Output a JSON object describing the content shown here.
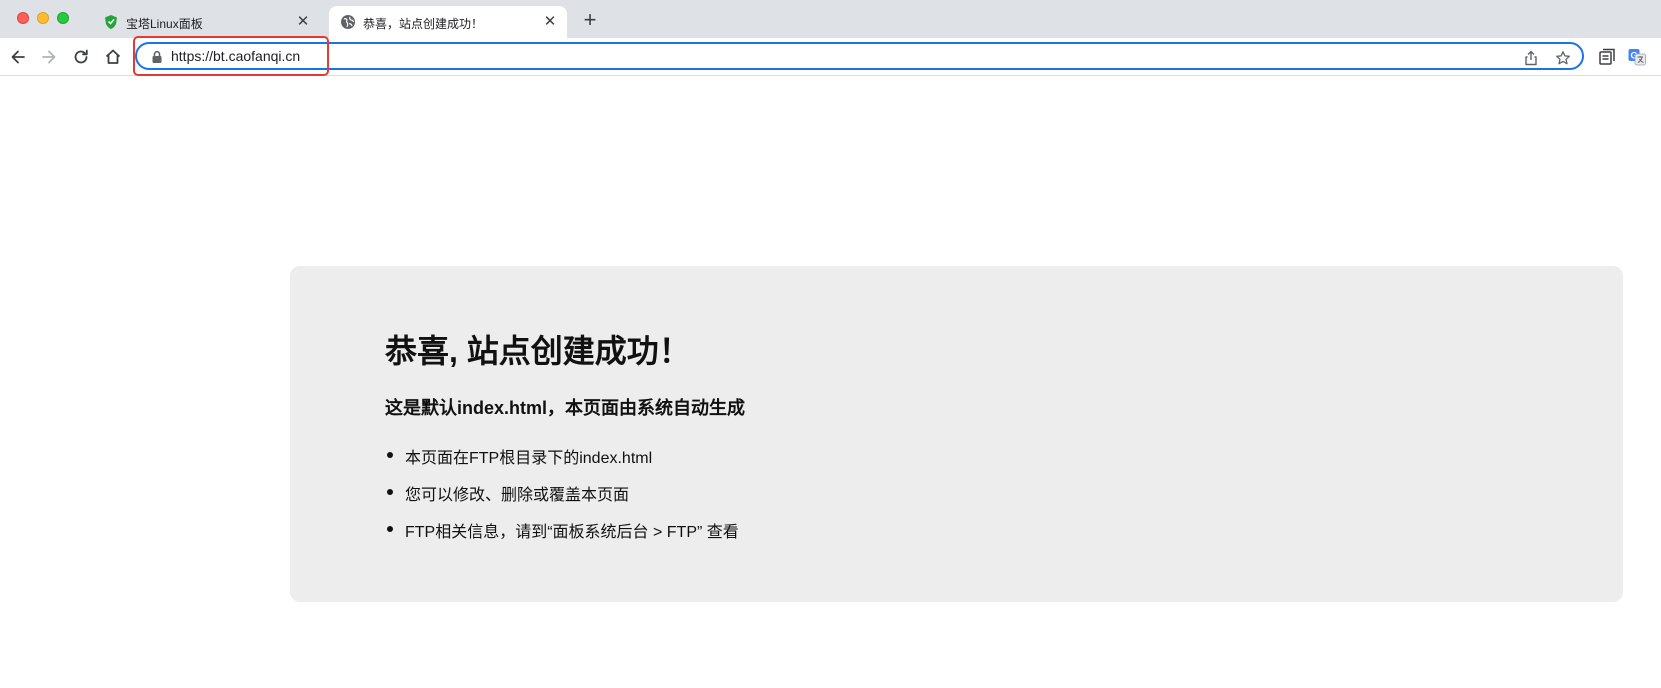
{
  "browser": {
    "tabs": [
      {
        "title": "宝塔Linux面板",
        "favicon": "bt-shield-icon",
        "active": false
      },
      {
        "title": "恭喜，站点创建成功！",
        "favicon": "globe-icon",
        "active": true
      }
    ],
    "close_glyph": "✕",
    "newtab_glyph": "+",
    "url": "https://bt.caofanqi.cn",
    "colors": {
      "accent": "#1a73e8",
      "highlight": "#e53935",
      "tabbar": "#dee1e6"
    }
  },
  "page": {
    "heading": "恭喜, 站点创建成功！",
    "subheading": "这是默认index.html，本页面由系统自动生成",
    "items": [
      "本页面在FTP根目录下的index.html",
      "您可以修改、删除或覆盖本页面",
      "FTP相关信息，请到“面板系统后台 > FTP” 查看"
    ]
  }
}
